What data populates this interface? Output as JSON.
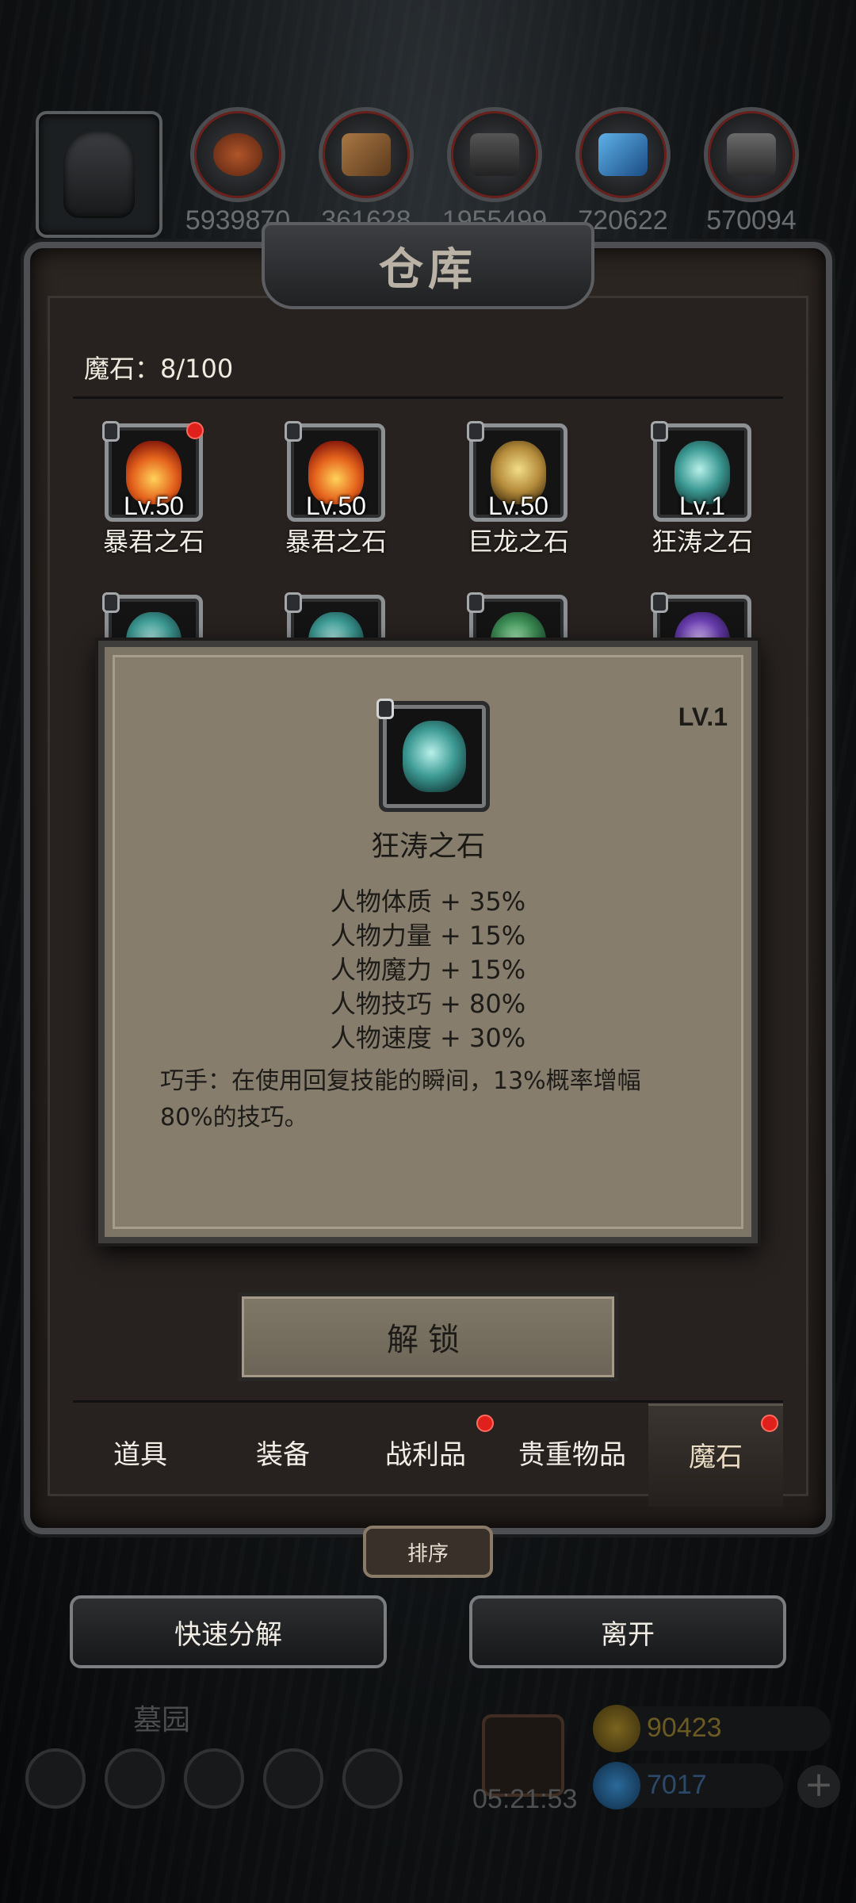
{
  "resources": [
    {
      "icon": "meat-icon",
      "value": "5939870"
    },
    {
      "icon": "wood-icon",
      "value": "361628"
    },
    {
      "icon": "iron-icon",
      "value": "1955499"
    },
    {
      "icon": "crystal-icon",
      "value": "720622"
    },
    {
      "icon": "steel-icon",
      "value": "570094"
    }
  ],
  "window": {
    "title": "仓库"
  },
  "stone_count": "魔石：8/100",
  "grid": [
    {
      "level": "Lv.50",
      "name": "暴君之石",
      "gem": "fire",
      "new": true
    },
    {
      "level": "Lv.50",
      "name": "暴君之石",
      "gem": "fire",
      "new": false
    },
    {
      "level": "Lv.50",
      "name": "巨龙之石",
      "gem": "dragon",
      "new": false
    },
    {
      "level": "Lv.1",
      "name": "狂涛之石",
      "gem": "storm",
      "new": false
    },
    {
      "gem": "storm"
    },
    {
      "gem": "storm"
    },
    {
      "gem": "green"
    },
    {
      "gem": "purple"
    }
  ],
  "popup": {
    "level": "LV.1",
    "name": "狂涛之石",
    "stats": [
      "人物体质 + 35%",
      "人物力量 + 15%",
      "人物魔力 + 15%",
      "人物技巧 + 80%",
      "人物速度 + 30%"
    ],
    "skill_line1": "巧手：在使用回复技能的瞬间，13%概率增幅",
    "skill_line2": "80%的技巧。"
  },
  "unlock_label": "解锁",
  "tabs": [
    "道具",
    "装备",
    "战利品",
    "贵重物品",
    "魔石"
  ],
  "active_tab": "魔石",
  "sort_label": "排序",
  "quick_decompose_label": "快速分解",
  "leave_label": "离开",
  "hud": {
    "location": "墓园",
    "timer": "05:21:53",
    "gold": "90423",
    "gems": "7017"
  },
  "colors": {
    "notification": "#e0201b",
    "gold_text": "#6b5a22",
    "gem_text": "#2b4a6b"
  }
}
